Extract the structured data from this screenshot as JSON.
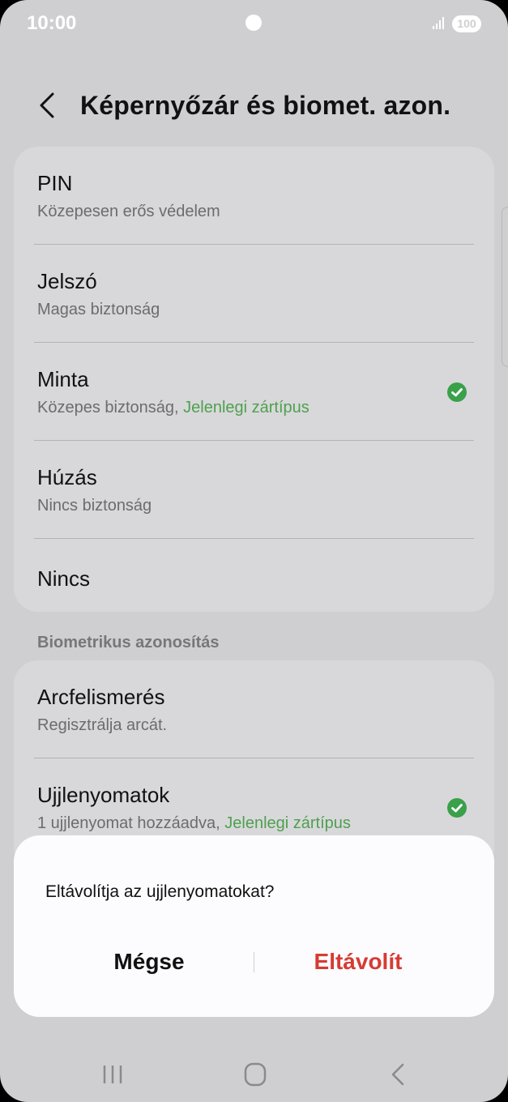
{
  "status_bar": {
    "time": "10:00",
    "battery": "100",
    "signal_icon": "signal-icon"
  },
  "header": {
    "title": "Képernyőzár és biomet. azon.",
    "back_icon": "back-arrow-icon"
  },
  "lock_types": [
    {
      "title": "PIN",
      "subtitle": "Közepesen erős védelem",
      "current": false
    },
    {
      "title": "Jelszó",
      "subtitle": "Magas biztonság",
      "current": false
    },
    {
      "title": "Minta",
      "subtitle": "Közepes biztonság, ",
      "current_label": "Jelenlegi zártípus",
      "current": true
    },
    {
      "title": "Húzás",
      "subtitle": "Nincs biztonság",
      "current": false
    },
    {
      "title": "Nincs"
    }
  ],
  "biometrics": {
    "section_label": "Biometrikus azonosítás",
    "items": [
      {
        "title": "Arcfelismerés",
        "subtitle": "Regisztrálja arcát.",
        "current": false
      },
      {
        "title": "Ujjlenyomatok",
        "subtitle": "1 ujjlenyomat hozzáadva, ",
        "current_label": "Jelenlegi zártípus",
        "current": true
      }
    ]
  },
  "dialog": {
    "message": "Eltávolítja az ujjlenyomatokat?",
    "cancel_label": "Mégse",
    "confirm_label": "Eltávolít"
  },
  "colors": {
    "accent_green": "#4fa04f",
    "destructive_red": "#d63b33",
    "background": "#cfcfd2",
    "card": "#d8d8db"
  }
}
